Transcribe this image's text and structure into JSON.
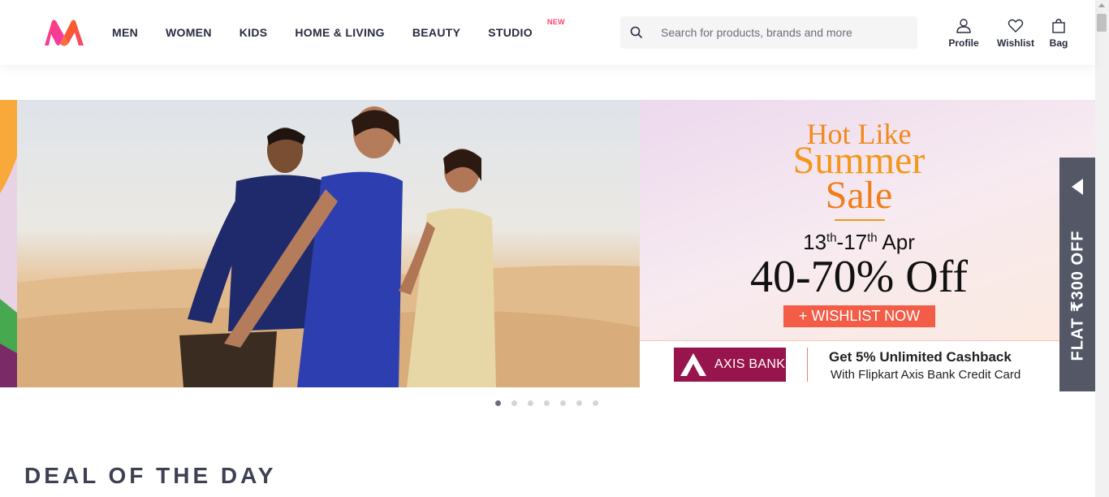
{
  "header": {
    "nav": [
      {
        "label": "MEN"
      },
      {
        "label": "WOMEN"
      },
      {
        "label": "KIDS"
      },
      {
        "label": "HOME & LIVING"
      },
      {
        "label": "BEAUTY"
      },
      {
        "label": "STUDIO",
        "badge": "NEW"
      }
    ],
    "search": {
      "placeholder": "Search for products, brands and more"
    },
    "actions": [
      {
        "label": "Profile",
        "icon": "user-icon"
      },
      {
        "label": "Wishlist",
        "icon": "heart-icon"
      },
      {
        "label": "Bag",
        "icon": "bag-icon"
      }
    ]
  },
  "banner": {
    "headline_1": "Hot Like",
    "headline_2": "Summer",
    "headline_3": "Sale",
    "dates_start": "13",
    "dates_start_suffix": "th",
    "dates_sep": "-17",
    "dates_end_suffix": "th",
    "dates_month": " Apr",
    "offer": "40-70% Off",
    "cta": "+ WISHLIST NOW",
    "bank_name": "AXIS BANK",
    "bank_offer_title": "Get 5% Unlimited Cashback",
    "bank_offer_sub": "With Flipkart Axis Bank Credit Card"
  },
  "side_offer": {
    "label": "FLAT ₹300 OFF"
  },
  "carousel": {
    "total": 7,
    "active_index": 0
  },
  "sections": {
    "deal_title": "DEAL OF THE DAY"
  },
  "colors": {
    "brand_pink": "#ff3f6c",
    "promo_orange": "#f29718",
    "cta_red": "#f35c47",
    "axis_maroon": "#97144d"
  }
}
